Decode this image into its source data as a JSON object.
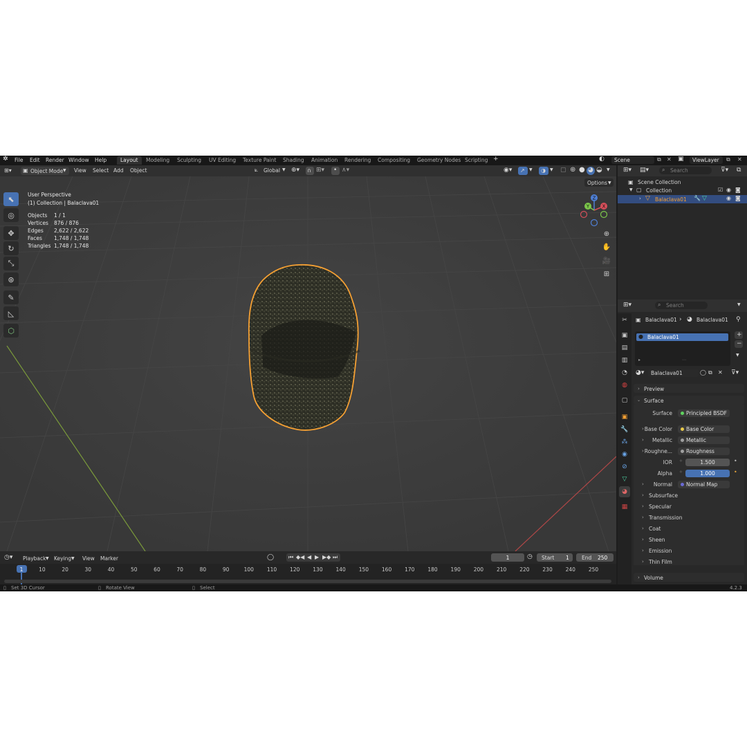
{
  "menu": [
    "File",
    "Edit",
    "Render",
    "Window",
    "Help"
  ],
  "workspaces": [
    "Layout",
    "Modeling",
    "Sculpting",
    "UV Editing",
    "Texture Paint",
    "Shading",
    "Animation",
    "Rendering",
    "Compositing",
    "Geometry Nodes",
    "Scripting"
  ],
  "active_workspace": "Layout",
  "scene": "Scene",
  "view_layer": "ViewLayer",
  "viewport_header": {
    "mode": "Object Mode",
    "menus": [
      "View",
      "Select",
      "Add",
      "Object"
    ],
    "orientation": "Global",
    "options": "Options"
  },
  "viewport_info": {
    "perspective": "User Perspective",
    "collection": "(1) Collection | Balaclava01",
    "stats": [
      {
        "label": "Objects",
        "value": "1 / 1"
      },
      {
        "label": "Vertices",
        "value": "876 / 876"
      },
      {
        "label": "Edges",
        "value": "2,622 / 2,622"
      },
      {
        "label": "Faces",
        "value": "1,748 / 1,748"
      },
      {
        "label": "Triangles",
        "value": "1,748 / 1,748"
      }
    ]
  },
  "gizmo": {
    "z": "Z",
    "y": "Y",
    "x": "X"
  },
  "outliner": {
    "search_placeholder": "Search",
    "scene_collection": "Scene Collection",
    "collection": "Collection",
    "object": "Balaclava01"
  },
  "properties": {
    "search_placeholder": "Search",
    "breadcrumb_object": "Balaclava01",
    "breadcrumb_material": "Balaclava01",
    "material_slot": "Balaclava01",
    "material_name": "Balaclava01",
    "panels": {
      "preview": "Preview",
      "surface": "Surface",
      "volume": "Volume"
    },
    "surface_rows": [
      {
        "label": "Surface",
        "value": "Principled BSDF",
        "dot": "#5fd35f"
      },
      {
        "label": "Base Color",
        "value": "Base Color",
        "dot": "#e6c84a"
      },
      {
        "label": "Metallic",
        "value": "Metallic",
        "dot": "#a0a0a0"
      },
      {
        "label": "Roughne...",
        "value": "Roughness",
        "dot": "#a0a0a0"
      },
      {
        "label": "IOR",
        "value": "1.500",
        "dot": "#a0a0a0"
      },
      {
        "label": "Alpha",
        "value": "1.000",
        "dot": "#a0a0a0"
      },
      {
        "label": "Normal",
        "value": "Normal Map",
        "dot": "#6b6bd6"
      }
    ],
    "subpanels": [
      "Subsurface",
      "Specular",
      "Transmission",
      "Coat",
      "Sheen",
      "Emission",
      "Thin Film"
    ]
  },
  "timeline": {
    "menus": [
      "Playback",
      "Keying",
      "View",
      "Marker"
    ],
    "current_frame": "1",
    "start_label": "Start",
    "start": "1",
    "end_label": "End",
    "end": "250",
    "ticks": [
      "1",
      "10",
      "20",
      "30",
      "40",
      "50",
      "60",
      "70",
      "80",
      "90",
      "100",
      "110",
      "120",
      "130",
      "140",
      "150",
      "160",
      "170",
      "180",
      "190",
      "200",
      "210",
      "220",
      "230",
      "240",
      "250"
    ]
  },
  "status_bar": {
    "left": "Set 3D Cursor",
    "middle": "Rotate View",
    "right": "Select",
    "version": "4.2.3"
  },
  "colors": {
    "accent": "#4772b3",
    "selection_outline": "#f5a033",
    "viewport_bg": "#3c3c3c"
  }
}
